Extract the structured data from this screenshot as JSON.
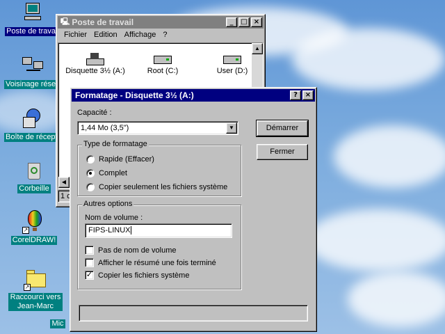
{
  "desktop": {
    "icons": [
      {
        "label": "Poste de travail",
        "icon": "computer-icon"
      },
      {
        "label": "Voisinage réseau",
        "icon": "network-icon"
      },
      {
        "label": "Boîte de réception",
        "icon": "inbox-icon"
      },
      {
        "label": "Corbeille",
        "icon": "recycle-bin-icon"
      },
      {
        "label": "CorelDRAW!",
        "icon": "coreldraw-icon"
      },
      {
        "label": "Raccourci vers Jean-Marc",
        "icon": "folder-icon"
      },
      {
        "label": "Mic",
        "icon": "partial-icon"
      }
    ]
  },
  "explorer": {
    "title": "Poste de travail",
    "menu": [
      "Fichier",
      "Edition",
      "Affichage",
      "?"
    ],
    "items": [
      {
        "label": "Disquette 3½ (A:)",
        "icon": "floppy-drive-icon"
      },
      {
        "label": "Root (C:)",
        "icon": "hard-drive-icon"
      },
      {
        "label": "User (D:)",
        "icon": "hard-drive-icon"
      }
    ],
    "status": "1 c"
  },
  "dialog": {
    "title": "Formatage - Disquette 3½ (A:)",
    "capacity_label": "Capacité :",
    "capacity_value": "1,44 Mo (3,5\")",
    "format_type_legend": "Type de formatage",
    "format_options": [
      {
        "label": "Rapide (Effacer)",
        "selected": false
      },
      {
        "label": "Complet",
        "selected": true
      },
      {
        "label": "Copier seulement les fichiers système",
        "selected": false
      }
    ],
    "other_options_legend": "Autres options",
    "volume_label": "Nom de volume :",
    "volume_value": "FIPS-LINUX",
    "checkboxes": [
      {
        "label": "Pas de nom de volume",
        "checked": false
      },
      {
        "label": "Afficher le résumé une fois terminé",
        "checked": false
      },
      {
        "label": "Copier les fichiers système",
        "checked": true
      }
    ],
    "start_button": "Démarrer",
    "close_button": "Fermer",
    "progress_value": 0
  }
}
